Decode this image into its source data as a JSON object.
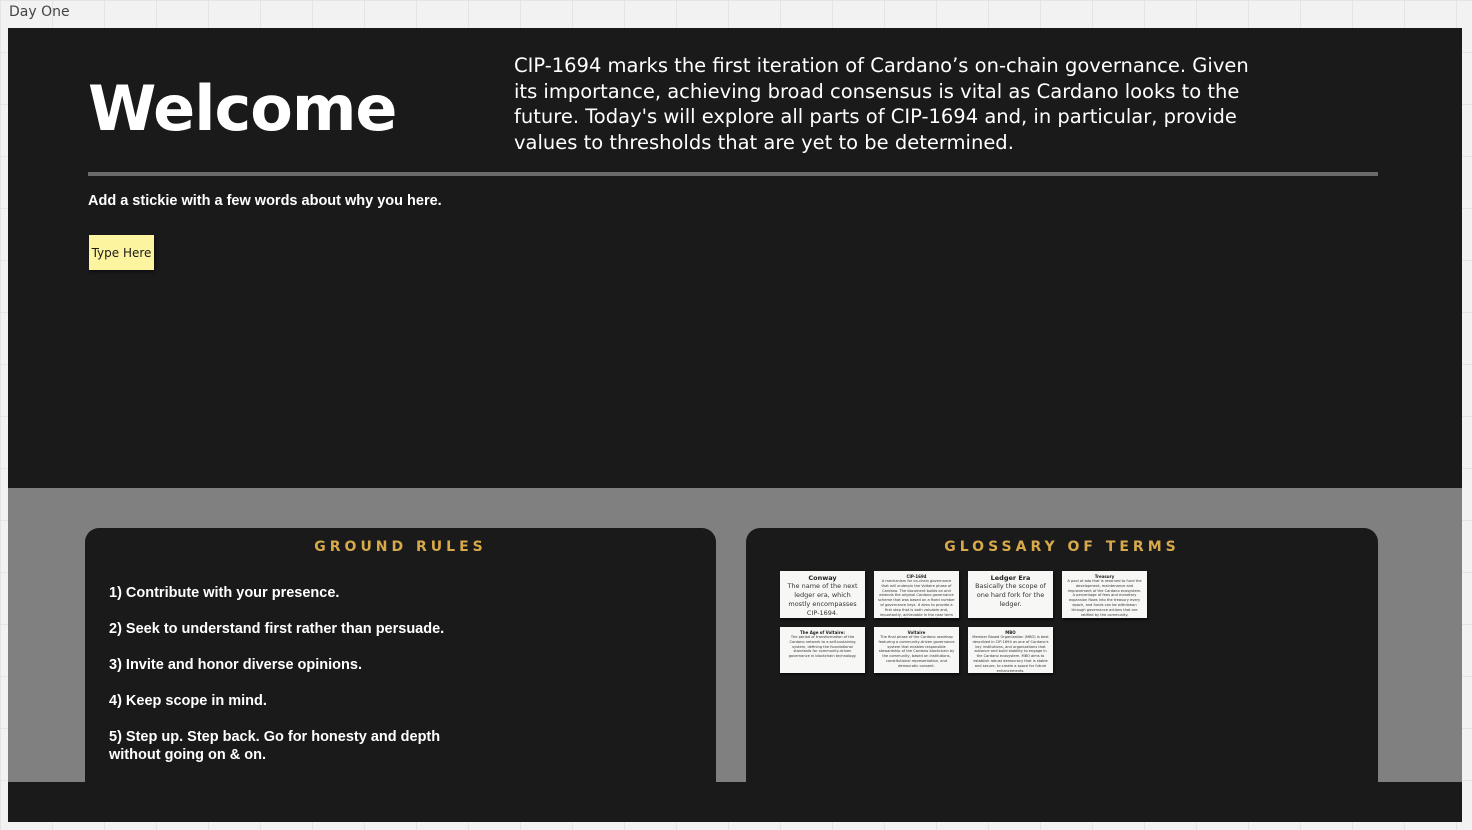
{
  "frame": {
    "label": "Day One"
  },
  "header": {
    "title": "Welcome",
    "intro": "CIP-1694 marks the first iteration of Cardano’s on-chain governance. Given its importance, achieving broad consensus is vital as Cardano looks to the future. Today's will explore all parts of CIP-1694 and, in particular, provide values to thresholds that are yet to be determined."
  },
  "prompt": {
    "text": "Add a stickie with a few words about why you here."
  },
  "sticky": {
    "label": "Type Here"
  },
  "ground_rules": {
    "title": "GROUND RULES",
    "items": [
      "1) Contribute with your presence.",
      "2) Seek to understand first rather than persuade.",
      "3) Invite and honor diverse opinions.",
      "4) Keep scope in mind.",
      "5) Step up. Step back. Go for honesty and depth without going on & on."
    ]
  },
  "glossary": {
    "title": "GLOSSARY OF TERMS",
    "cards": [
      {
        "term": "Conway",
        "definition": "The name of the next ledger era, which mostly encompasses CIP-1694."
      },
      {
        "term": "CIP-1694",
        "definition": "A mechanism for on-chain governance that will underpin the Voltaire phase of Cardano. The document builds on and extends the original Cardano governance scheme that was based on a fixed number of governance keys. It aims to provide a first step that is both valuable and, importantly, achievable in the near term as part of the proposed Voltaire governance system."
      },
      {
        "term": "Ledger Era",
        "definition": "Basically the scope of one hard fork for the ledger."
      },
      {
        "term": "Treasury",
        "definition": "A pool of ada that is reserved to fund the development, maintenance and improvement of the Cardano ecosystem. A percentage of fees and monetary expansion flows into the treasury every epoch, and funds can be withdrawn through governance actions that are ratified by the community."
      },
      {
        "term": "The Age of Voltaire:",
        "definition": "The period of transformation of the Cardano network to a self-sustaining system, defining the foundational standards for community-driven governance in blockchain technology."
      },
      {
        "term": "Voltaire",
        "definition": "The final phase of the Cardano roadmap featuring a community-driven governance system that enables responsible stewardship of the Cardano blockchain by the community, based on institutions, constitutional representation, and democratic consent."
      },
      {
        "term": "MBO",
        "definition": "Member Based Organization (MBO) is best described in CIP-1694 as one of Cardano's key institutions, and organizations that advance and build stability to engage in the Cardano ecosystem. MBO aims to establish robust democracy that is stable and secure, to create a space for future enhancements."
      }
    ]
  }
}
